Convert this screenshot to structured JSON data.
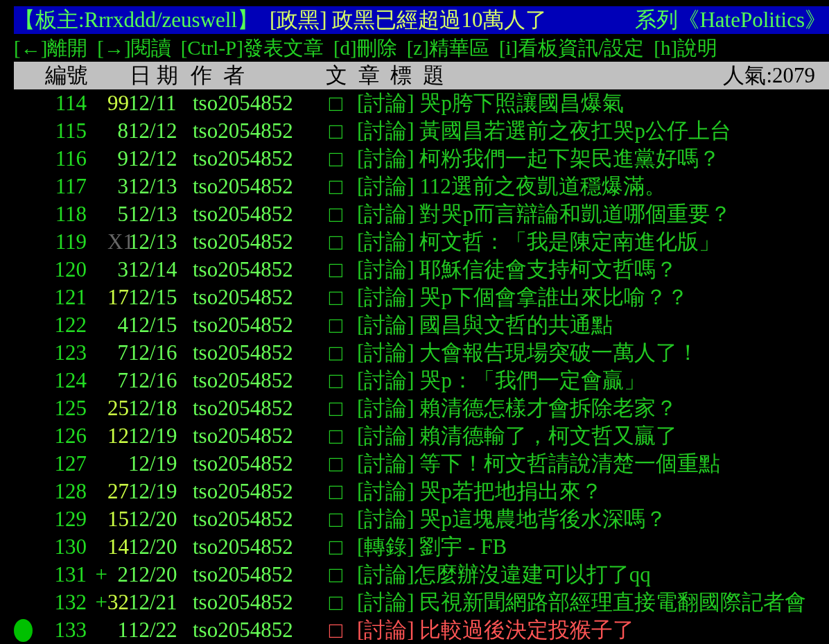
{
  "title_bar": {
    "moderators": "【板主:Rrrxddd/zeuswell】",
    "board_title": "[政黑] 政黑已經超過10萬人了",
    "series": "系列《HatePolitics》"
  },
  "key_menu": [
    "[←]離開",
    "[→]閱讀",
    "[Ctrl-P]發表文章",
    "[d]刪除",
    "[z]精華區",
    "[i]看板資訊/設定",
    "[h]說明"
  ],
  "columns": {
    "number": "編號",
    "date": "日 期",
    "author": "作  者",
    "title": "文  章  標  題",
    "popularity": "人氣:2079"
  },
  "rows": [
    {
      "number": "114",
      "push": {
        "text": "99",
        "color": "#ccff44"
      },
      "date": "12/11",
      "author": "tso2054852",
      "type_mark": "□",
      "title": "[討論] 哭p胯下照讓國昌爆氣",
      "selected": false
    },
    {
      "number": "115",
      "push": {
        "text": "8",
        "color": "#66ff55"
      },
      "date": "12/12",
      "author": "tso2054852",
      "type_mark": "□",
      "title": "[討論] 黃國昌若選前之夜扛哭p公仔上台",
      "selected": false
    },
    {
      "number": "116",
      "push": {
        "text": "9",
        "color": "#66ff55"
      },
      "date": "12/12",
      "author": "tso2054852",
      "type_mark": "□",
      "title": "[討論] 柯粉我們一起下架民進黨好嗎？",
      "selected": false
    },
    {
      "number": "117",
      "push": {
        "text": "3",
        "color": "#66ff55"
      },
      "date": "12/13",
      "author": "tso2054852",
      "type_mark": "□",
      "title": "[討論] 112選前之夜凱道穩爆滿。",
      "selected": false
    },
    {
      "number": "118",
      "push": {
        "text": "5",
        "color": "#66ff55"
      },
      "date": "12/13",
      "author": "tso2054852",
      "type_mark": "□",
      "title": "[討論] 對哭p而言辯論和凱道哪個重要？",
      "selected": false
    },
    {
      "number": "119",
      "push": {
        "text": "X1",
        "color": "#666666"
      },
      "date": "12/13",
      "author": "tso2054852",
      "type_mark": "□",
      "title": "[討論] 柯文哲：「我是陳定南進化版」",
      "selected": false
    },
    {
      "number": "120",
      "push": {
        "text": "3",
        "color": "#66ff55"
      },
      "date": "12/14",
      "author": "tso2054852",
      "type_mark": "□",
      "title": "[討論] 耶穌信徒會支持柯文哲嗎？",
      "selected": false
    },
    {
      "number": "121",
      "push": {
        "text": "17",
        "color": "#ccff44"
      },
      "date": "12/15",
      "author": "tso2054852",
      "type_mark": "□",
      "title": "[討論] 哭p下個會拿誰出來比喻？？",
      "selected": false
    },
    {
      "number": "122",
      "push": {
        "text": "4",
        "color": "#66ff55"
      },
      "date": "12/15",
      "author": "tso2054852",
      "type_mark": "□",
      "title": "[討論] 國昌與文哲的共通點",
      "selected": false
    },
    {
      "number": "123",
      "push": {
        "text": "7",
        "color": "#66ff55"
      },
      "date": "12/16",
      "author": "tso2054852",
      "type_mark": "□",
      "title": "[討論] 大會報告現場突破一萬人了！",
      "selected": false
    },
    {
      "number": "124",
      "push": {
        "text": "7",
        "color": "#66ff55"
      },
      "date": "12/16",
      "author": "tso2054852",
      "type_mark": "□",
      "title": "[討論] 哭p：「我們一定會贏」",
      "selected": false
    },
    {
      "number": "125",
      "push": {
        "text": "25",
        "color": "#ccff44"
      },
      "date": "12/18",
      "author": "tso2054852",
      "type_mark": "□",
      "title": "[討論] 賴清德怎樣才會拆除老家？",
      "selected": false
    },
    {
      "number": "126",
      "push": {
        "text": "12",
        "color": "#ccff44"
      },
      "date": "12/19",
      "author": "tso2054852",
      "type_mark": "□",
      "title": "[討論] 賴清德輸了，柯文哲又贏了",
      "selected": false
    },
    {
      "number": "127",
      "date": "12/19",
      "author": "tso2054852",
      "type_mark": "□",
      "title": "[討論] 等下！柯文哲請說清楚一個重點",
      "selected": false
    },
    {
      "number": "128",
      "push": {
        "text": "27",
        "color": "#ccff44"
      },
      "date": "12/19",
      "author": "tso2054852",
      "type_mark": "□",
      "title": "[討論] 哭p若把地捐出來？",
      "selected": false
    },
    {
      "number": "129",
      "push": {
        "text": "15",
        "color": "#ccff44"
      },
      "date": "12/20",
      "author": "tso2054852",
      "type_mark": "□",
      "title": "[討論] 哭p這塊農地背後水深嗎？",
      "selected": false
    },
    {
      "number": "130",
      "push": {
        "text": "14",
        "color": "#ccff44"
      },
      "date": "12/20",
      "author": "tso2054852",
      "type_mark": "□",
      "title": "[轉錄] 劉宇 - FB",
      "selected": false
    },
    {
      "number": "131",
      "unread": "+",
      "push": {
        "text": "2",
        "color": "#66ff55"
      },
      "date": "12/20",
      "author": "tso2054852",
      "type_mark": "□",
      "title": "[討論]怎麼辦沒違建可以打了qq",
      "selected": false
    },
    {
      "number": "132",
      "unread": "+",
      "push": {
        "text": "32",
        "color": "#ccff44"
      },
      "date": "12/21",
      "author": "tso2054852",
      "type_mark": "□",
      "title": "[討論] 民視新聞網路部經理直接電翻國際記者會",
      "selected": false
    },
    {
      "number": "133",
      "push": {
        "text": "1",
        "color": "#66ff55"
      },
      "date": "12/22",
      "author": "tso2054852",
      "type_mark": "□",
      "title": "[討論] 比較過後決定投猴子了",
      "selected": true
    }
  ]
}
